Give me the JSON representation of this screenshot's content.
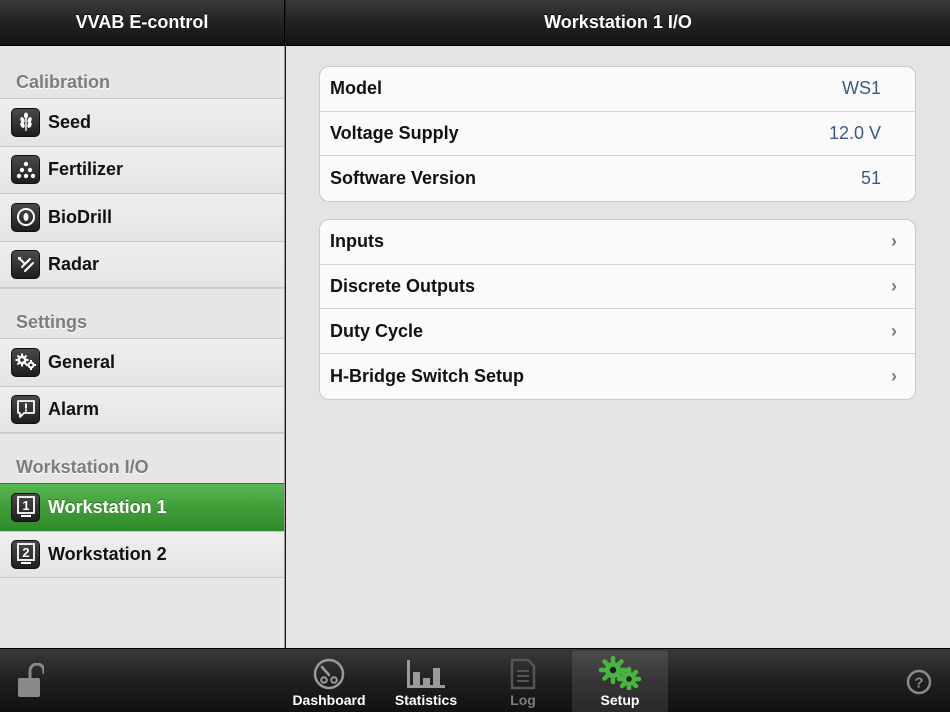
{
  "header": {
    "left_title": "VVAB E-control",
    "right_title": "Workstation 1 I/O"
  },
  "sidebar": {
    "sections": [
      {
        "title": "Calibration",
        "items": [
          {
            "label": "Seed",
            "icon": "seed-icon"
          },
          {
            "label": "Fertilizer",
            "icon": "fertilizer-icon"
          },
          {
            "label": "BioDrill",
            "icon": "biodrill-icon"
          },
          {
            "label": "Radar",
            "icon": "radar-icon"
          }
        ]
      },
      {
        "title": "Settings",
        "items": [
          {
            "label": "General",
            "icon": "gears-icon"
          },
          {
            "label": "Alarm",
            "icon": "alarm-icon"
          }
        ]
      },
      {
        "title": "Workstation I/O",
        "items": [
          {
            "label": "Workstation 1",
            "icon": "workstation-1-icon",
            "active": true
          },
          {
            "label": "Workstation 2",
            "icon": "workstation-2-icon"
          }
        ]
      }
    ]
  },
  "info": {
    "rows": [
      {
        "label": "Model",
        "value": "WS1"
      },
      {
        "label": "Voltage Supply",
        "value": "12.0 V"
      },
      {
        "label": "Software Version",
        "value": "51"
      }
    ]
  },
  "nav": {
    "rows": [
      {
        "label": "Inputs"
      },
      {
        "label": "Discrete Outputs"
      },
      {
        "label": "Duty Cycle"
      },
      {
        "label": "H-Bridge Switch Setup"
      }
    ]
  },
  "tabbar": {
    "tabs": [
      {
        "label": "Dashboard",
        "icon": "speedometer-icon"
      },
      {
        "label": "Statistics",
        "icon": "bar-chart-icon"
      },
      {
        "label": "Log",
        "icon": "log-document-icon"
      },
      {
        "label": "Setup",
        "icon": "setup-gears-icon",
        "selected": true
      }
    ],
    "lock_icon": "unlocked-padlock-icon",
    "help_icon": "help-icon"
  },
  "colors": {
    "accent_green": "#46a33e",
    "value_blue": "#3c5a86"
  }
}
